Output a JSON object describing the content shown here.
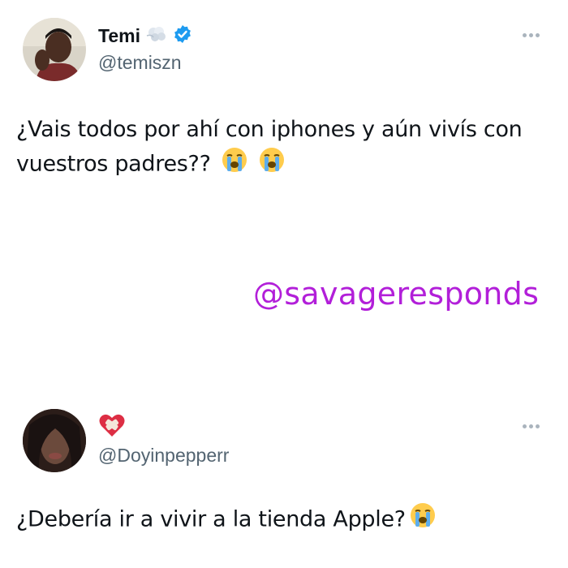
{
  "tweet1": {
    "display_name": "Temi",
    "handle": "@temiszn",
    "text": "¿Vais todos por ahí con iphones y aún vivís con vuestros padres??",
    "emojis": [
      "loudly-crying-face-icon",
      "loudly-crying-face-icon"
    ]
  },
  "watermark": "@savageresponds",
  "tweet2": {
    "handle": "@Doyinpepperr",
    "text": "¿Debería ir a vivir a la tienda Apple?",
    "emojis": [
      "loudly-crying-face-icon"
    ],
    "name_icon": "mending-heart-icon"
  },
  "colors": {
    "verified": "#1d9bf0",
    "handle": "#536471",
    "watermark": "#b21fd9",
    "text": "#0f1419"
  }
}
